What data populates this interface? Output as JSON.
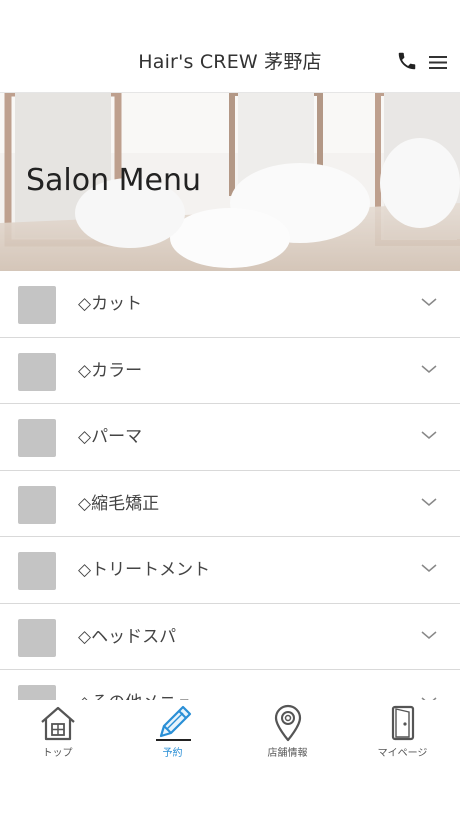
{
  "header": {
    "title": "Hair's CREW 茅野店"
  },
  "hero": {
    "title": "Salon Menu"
  },
  "menu": {
    "items": [
      {
        "label": "◇カット"
      },
      {
        "label": "◇カラー"
      },
      {
        "label": "◇パーマ"
      },
      {
        "label": "◇縮毛矯正"
      },
      {
        "label": "◇トリートメント"
      },
      {
        "label": "◇ヘッドスパ"
      },
      {
        "label": "◇その他メニュー"
      }
    ]
  },
  "tabs": [
    {
      "label": "トップ",
      "icon": "home-icon"
    },
    {
      "label": "予約",
      "icon": "pencil-icon"
    },
    {
      "label": "店舗情報",
      "icon": "map-pin-icon"
    },
    {
      "label": "マイページ",
      "icon": "door-icon"
    }
  ],
  "colors": {
    "accent": "#2a8fd6",
    "thumb": "#c4c4c4"
  }
}
